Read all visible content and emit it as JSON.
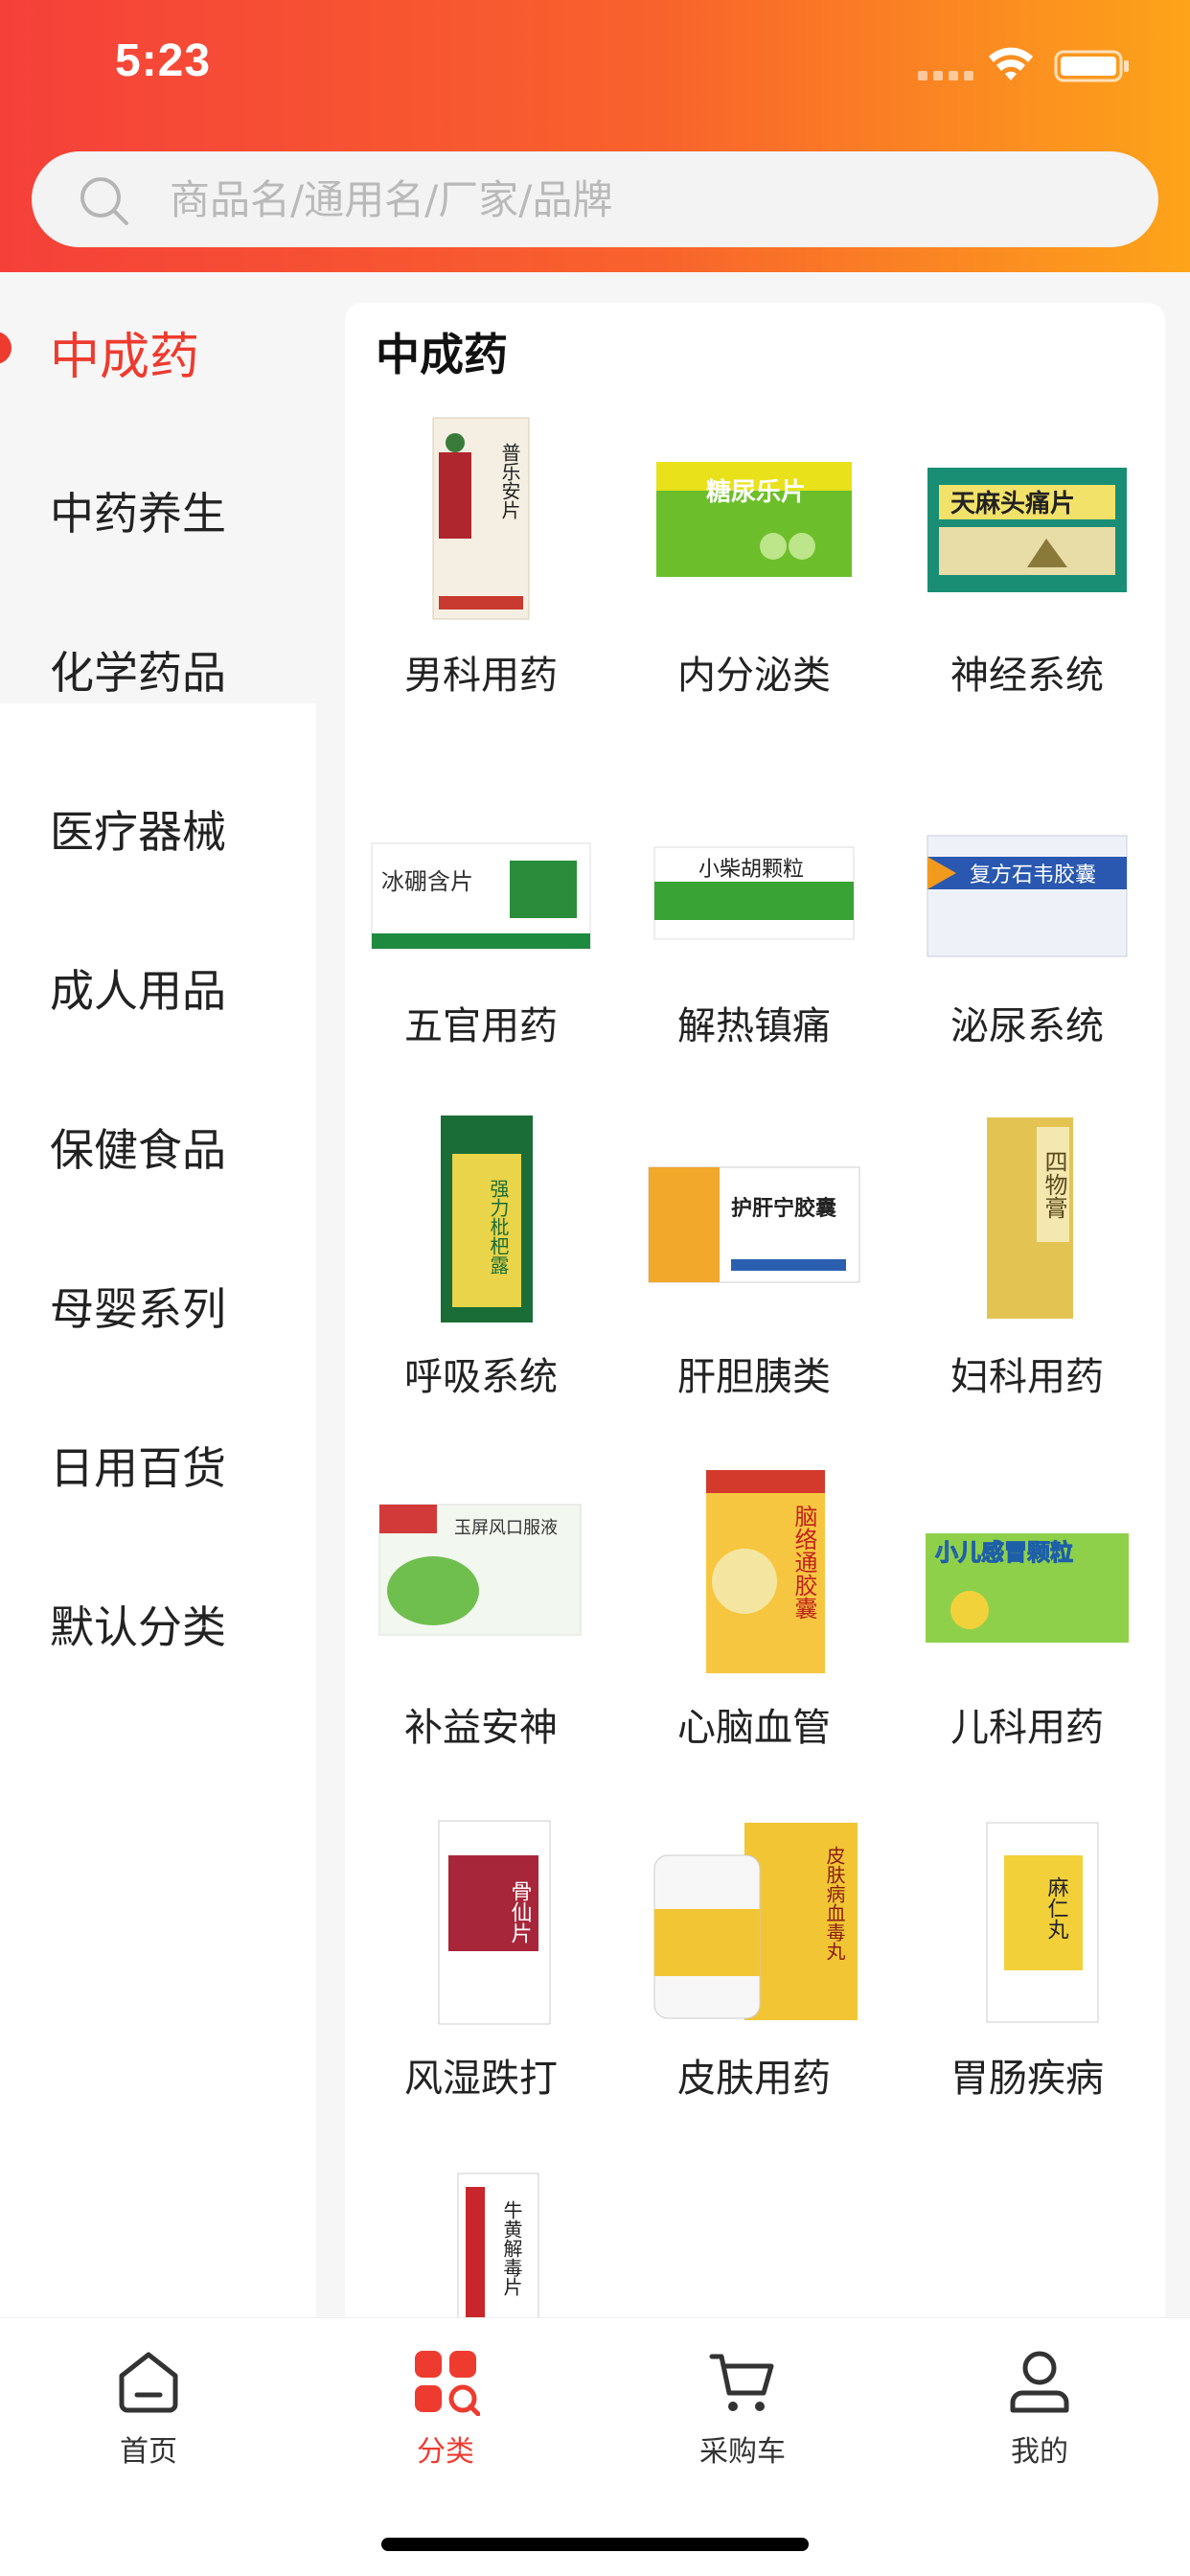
{
  "status": {
    "time": "5:23"
  },
  "search": {
    "placeholder": "商品名/通用名/厂家/品牌"
  },
  "sidebar": {
    "items": [
      {
        "label": "中成药",
        "active": true
      },
      {
        "label": "中药养生"
      },
      {
        "label": "化学药品"
      },
      {
        "label": "医疗器械"
      },
      {
        "label": "成人用品"
      },
      {
        "label": "保健食品"
      },
      {
        "label": "母婴系列"
      },
      {
        "label": "日用百货"
      },
      {
        "label": "默认分类"
      }
    ]
  },
  "panel": {
    "title": "中成药",
    "items": [
      {
        "label": "男科用药",
        "thumb_text": "普乐安片"
      },
      {
        "label": "内分泌类",
        "thumb_text": "糖尿乐片"
      },
      {
        "label": "神经系统",
        "thumb_text": "天麻头痛片"
      },
      {
        "label": "五官用药",
        "thumb_text": "冰硼含片"
      },
      {
        "label": "解热镇痛",
        "thumb_text": "小柴胡颗粒"
      },
      {
        "label": "泌尿系统",
        "thumb_text": "复方石韦胶囊"
      },
      {
        "label": "呼吸系统",
        "thumb_text": "强力枇杷露"
      },
      {
        "label": "肝胆胰类",
        "thumb_text": "护肝宁胶囊"
      },
      {
        "label": "妇科用药",
        "thumb_text": "四物膏"
      },
      {
        "label": "补益安神",
        "thumb_text": "玉屏风口服液"
      },
      {
        "label": "心脑血管",
        "thumb_text": "脑络通胶囊"
      },
      {
        "label": "儿科用药",
        "thumb_text": "小儿感冒颗粒"
      },
      {
        "label": "风湿跌打",
        "thumb_text": "骨仙片"
      },
      {
        "label": "皮肤用药",
        "thumb_text": "皮肤病血毒丸"
      },
      {
        "label": "胃肠疾病",
        "thumb_text": "麻仁丸"
      },
      {
        "label": "",
        "thumb_text": "牛黄解毒片"
      }
    ]
  },
  "tabs": [
    {
      "label": "首页"
    },
    {
      "label": "分类",
      "active": true
    },
    {
      "label": "采购车"
    },
    {
      "label": "我的"
    }
  ],
  "colors": {
    "accent": "#ee3b2f",
    "header_start": "#f5403a",
    "header_end": "#fda41a"
  }
}
